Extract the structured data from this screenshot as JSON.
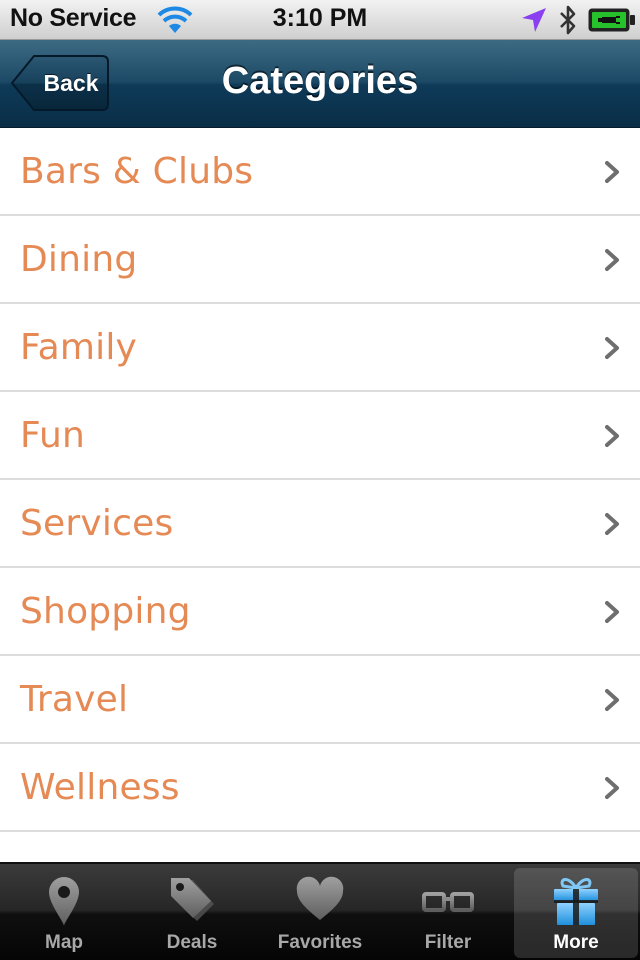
{
  "status_bar": {
    "carrier": "No Service",
    "time": "3:10 PM",
    "icons": [
      "wifi-icon",
      "location-arrow-icon",
      "bluetooth-icon",
      "battery-charging-icon"
    ]
  },
  "nav": {
    "back_label": "Back",
    "title": "Categories"
  },
  "categories": [
    {
      "label": "Bars & Clubs"
    },
    {
      "label": "Dining"
    },
    {
      "label": "Family"
    },
    {
      "label": "Fun"
    },
    {
      "label": "Services"
    },
    {
      "label": "Shopping"
    },
    {
      "label": "Travel"
    },
    {
      "label": "Wellness"
    }
  ],
  "tabs": [
    {
      "label": "Map",
      "icon": "map-pin-icon",
      "active": false
    },
    {
      "label": "Deals",
      "icon": "price-tag-icon",
      "active": false
    },
    {
      "label": "Favorites",
      "icon": "heart-icon",
      "active": false
    },
    {
      "label": "Filter",
      "icon": "glasses-icon",
      "active": false
    },
    {
      "label": "More",
      "icon": "gift-icon",
      "active": true
    }
  ],
  "colors": {
    "category_text": "#e58a55",
    "nav_bar": "#0e3a58",
    "tab_bar": "#1a1a1a",
    "tab_active_icon": "#3aa6e6",
    "tab_inactive": "#a8a8a8"
  }
}
